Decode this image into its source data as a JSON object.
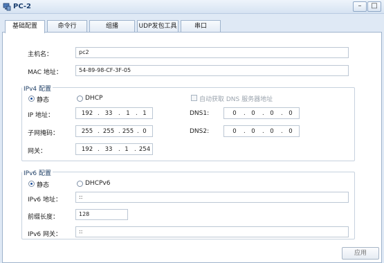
{
  "window": {
    "title": "PC-2",
    "minimize": "–",
    "maximize": "□"
  },
  "tabs": [
    {
      "label": "基础配置",
      "active": true
    },
    {
      "label": "命令行",
      "active": false
    },
    {
      "label": "组播",
      "active": false
    },
    {
      "label": "UDP发包工具",
      "active": false
    },
    {
      "label": "串口",
      "active": false
    }
  ],
  "basic": {
    "hostname_label": "主机名：",
    "hostname_value": "pc2",
    "mac_label": "MAC 地址：",
    "mac_value": "54-89-98-CF-3F-05"
  },
  "ipv4": {
    "legend": "IPv4 配置",
    "static_label": "静态",
    "dhcp_label": "DHCP",
    "auto_dns_label": "自动获取 DNS 服务器地址",
    "ip_label": "IP 地址：",
    "ip": [
      "192",
      "33",
      "1",
      "1"
    ],
    "mask_label": "子网掩码：",
    "mask": [
      "255",
      "255",
      "255",
      "0"
    ],
    "gateway_label": "网关：",
    "gateway": [
      "192",
      "33",
      "1",
      "254"
    ],
    "dns1_label": "DNS1:",
    "dns1": [
      "0",
      "0",
      "0",
      "0"
    ],
    "dns2_label": "DNS2:",
    "dns2": [
      "0",
      "0",
      "0",
      "0"
    ],
    "mode": "static"
  },
  "ipv6": {
    "legend": "IPv6 配置",
    "static_label": "静态",
    "dhcp_label": "DHCPv6",
    "addr_label": "IPv6 地址：",
    "addr_value": "::",
    "prefix_label": "前缀长度：",
    "prefix_value": "128",
    "gateway_label": "IPv6 网关：",
    "gateway_value": "::",
    "mode": "static"
  },
  "apply_label": "应用",
  "colors": {
    "accent": "#1c4f9c",
    "titlebar": "#d6e3f2",
    "border": "#9eb3cc"
  }
}
